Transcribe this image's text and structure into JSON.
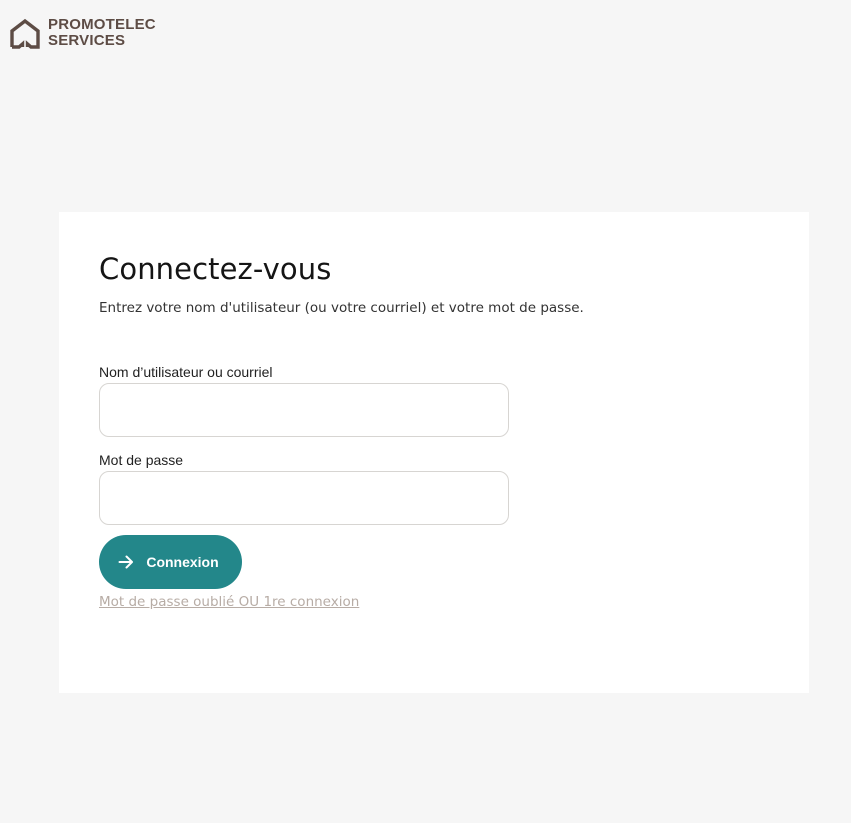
{
  "brand": {
    "line1": "PROMOTELEC",
    "line2": "SERVICES",
    "icon": "house-logo-icon",
    "color": "#5d4c45"
  },
  "login": {
    "title": "Connectez-vous",
    "subtitle": "Entrez votre nom d'utilisateur (ou votre courriel) et votre mot de passe.",
    "username_label": "Nom d’utilisateur ou courriel",
    "username_value": "",
    "username_placeholder": "",
    "password_label": "Mot de passe",
    "password_value": "",
    "password_placeholder": "",
    "submit_label": "Connexion",
    "submit_icon": "arrow-right-icon",
    "forgot_link": "Mot de passe oublié OU 1re connexion"
  },
  "colors": {
    "accent": "#23878a",
    "background": "#f6f6f6",
    "card": "#ffffff",
    "link": "#b7aca5"
  }
}
